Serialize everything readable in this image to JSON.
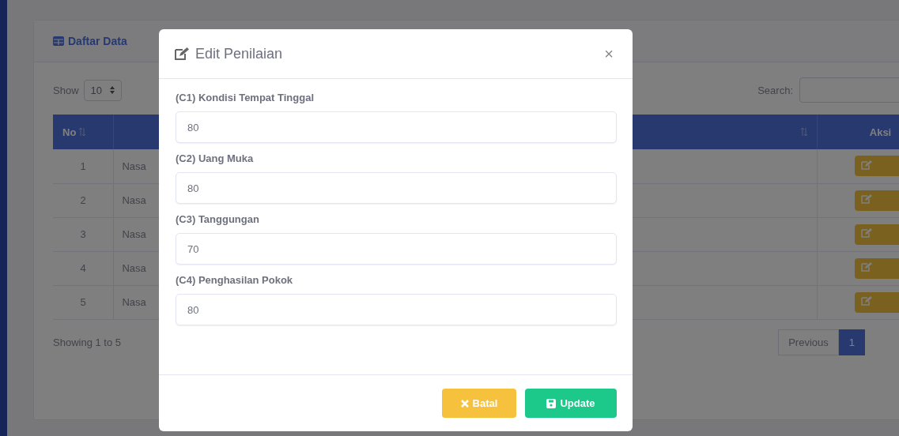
{
  "card": {
    "title": "Daftar Data",
    "length_label": "Show",
    "length_value": "10",
    "search_label": "Search:",
    "columns": [
      {
        "label": "No",
        "sortable": true
      },
      {
        "sortable": true
      },
      {
        "label": "Aksi",
        "sortable": false
      }
    ],
    "rows": [
      {
        "no": "1",
        "name": "Nasa"
      },
      {
        "no": "2",
        "name": "Nasa"
      },
      {
        "no": "3",
        "name": "Nasa"
      },
      {
        "no": "4",
        "name": "Nasa"
      },
      {
        "no": "5",
        "name": "Nasa"
      }
    ],
    "info": "Showing 1 to 5",
    "pagination": [
      {
        "label": "Previous",
        "selected": false
      },
      {
        "label": "1",
        "selected": true
      }
    ]
  },
  "modal": {
    "title": "Edit Penilaian",
    "close": "×",
    "fields": [
      {
        "label": "(C1) Kondisi Tempat Tinggal",
        "value": "80"
      },
      {
        "label": "(C2) Uang Muka",
        "value": "80"
      },
      {
        "label": "(C3) Tanggungan",
        "value": "70"
      },
      {
        "label": "(C4) Penghasilan Pokok",
        "value": "80"
      }
    ],
    "buttons": [
      {
        "kind": "cancel",
        "label": "Batal"
      },
      {
        "kind": "submit",
        "label": "Update"
      }
    ]
  }
}
